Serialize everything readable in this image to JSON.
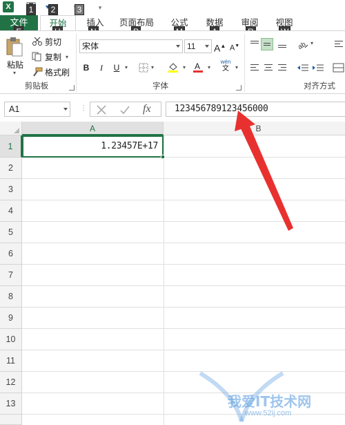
{
  "qat": {
    "app_icon": "X",
    "keytips": [
      "1",
      "2",
      "3"
    ]
  },
  "tabs": {
    "file": "文件",
    "items": [
      {
        "label": "开始",
        "keytip": "H"
      },
      {
        "label": "插入",
        "keytip": "N"
      },
      {
        "label": "页面布局",
        "keytip": "P"
      },
      {
        "label": "公式",
        "keytip": "M"
      },
      {
        "label": "数据",
        "keytip": "A"
      },
      {
        "label": "审阅",
        "keytip": "R"
      },
      {
        "label": "视图",
        "keytip": "W"
      }
    ],
    "file_keytip": "F"
  },
  "ribbon": {
    "clipboard": {
      "paste": "粘贴",
      "cut": "剪切",
      "copy": "复制",
      "format_painter": "格式刷",
      "group_label": "剪贴板"
    },
    "font": {
      "font_name": "宋体",
      "font_size": "11",
      "bold": "B",
      "italic": "I",
      "underline": "U",
      "grow": "A",
      "shrink": "A",
      "wen": "wén",
      "wen_sub": "文",
      "group_label": "字体"
    },
    "alignment": {
      "group_label": "对齐方式"
    }
  },
  "formula_bar": {
    "name_box": "A1",
    "fx": "fx",
    "value": "123456789123456000"
  },
  "grid": {
    "columns": [
      "A",
      "B"
    ],
    "rows": [
      "1",
      "2",
      "3",
      "4",
      "5",
      "6",
      "7",
      "8",
      "9",
      "10",
      "11",
      "12",
      "13"
    ],
    "cell_a1": "1.23457E+17"
  },
  "watermark": {
    "text": "我爱IT技术网",
    "url": "www.52ij.com"
  },
  "colors": {
    "accent": "#217346",
    "arrow": "#e8312f"
  }
}
